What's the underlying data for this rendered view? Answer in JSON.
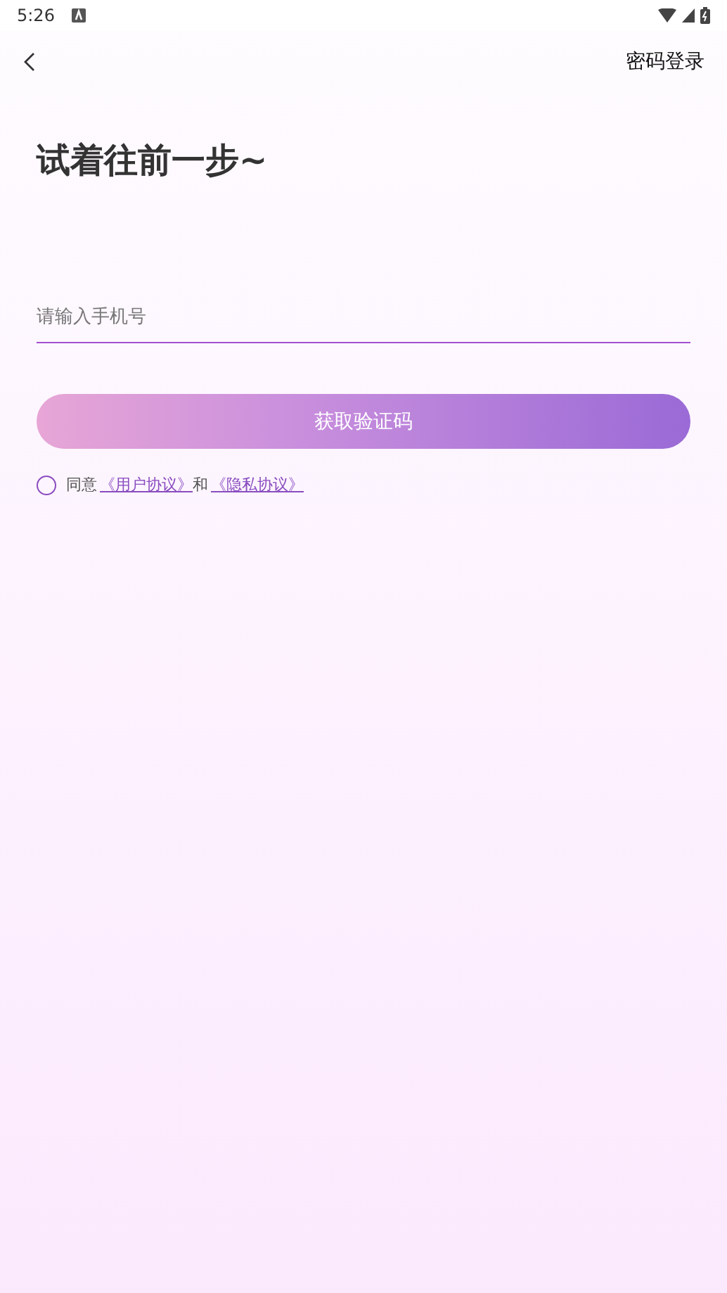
{
  "status_bar": {
    "time": "5:26"
  },
  "nav": {
    "action": "密码登录"
  },
  "title": "试着往前一步~",
  "phone_field": {
    "placeholder": "请输入手机号"
  },
  "submit_button": {
    "label": "获取验证码",
    "disabled": true
  },
  "agreement": {
    "checked": false,
    "parts": [
      {
        "kind": "text",
        "text": "同意"
      },
      {
        "kind": "link",
        "text": "《用户协议》"
      },
      {
        "kind": "text",
        "text": "和"
      },
      {
        "kind": "link",
        "text": "《隐私协议》"
      }
    ]
  }
}
